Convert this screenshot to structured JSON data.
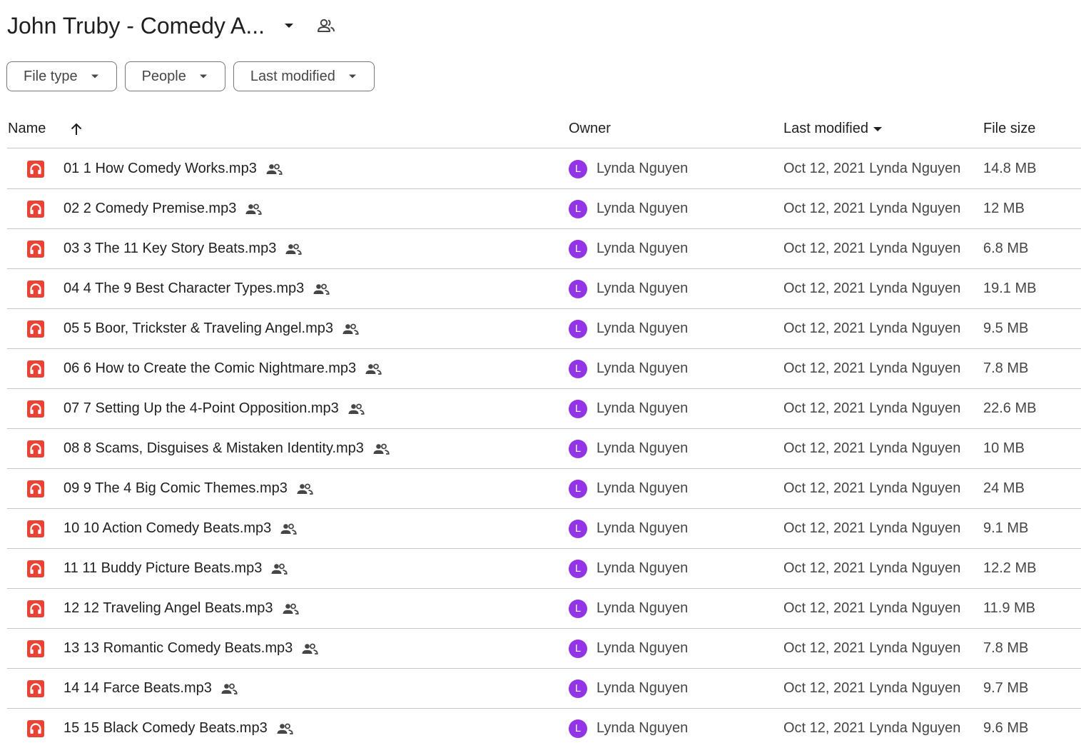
{
  "header": {
    "title": "John Truby - Comedy A..."
  },
  "filters": [
    {
      "label": "File type"
    },
    {
      "label": "People"
    },
    {
      "label": "Last modified"
    }
  ],
  "table": {
    "columns": {
      "name": "Name",
      "owner": "Owner",
      "modified": "Last modified",
      "size": "File size"
    },
    "rows": [
      {
        "name": "01 1 How Comedy Works.mp3",
        "owner": "Lynda Nguyen",
        "avatar": "L",
        "modified": "Oct 12, 2021 Lynda Nguyen",
        "size": "14.8 MB"
      },
      {
        "name": "02 2 Comedy Premise.mp3",
        "owner": "Lynda Nguyen",
        "avatar": "L",
        "modified": "Oct 12, 2021 Lynda Nguyen",
        "size": "12 MB"
      },
      {
        "name": "03 3 The 11 Key Story Beats.mp3",
        "owner": "Lynda Nguyen",
        "avatar": "L",
        "modified": "Oct 12, 2021 Lynda Nguyen",
        "size": "6.8 MB"
      },
      {
        "name": "04 4 The 9 Best Character Types.mp3",
        "owner": "Lynda Nguyen",
        "avatar": "L",
        "modified": "Oct 12, 2021 Lynda Nguyen",
        "size": "19.1 MB"
      },
      {
        "name": "05 5 Boor, Trickster & Traveling Angel.mp3",
        "owner": "Lynda Nguyen",
        "avatar": "L",
        "modified": "Oct 12, 2021 Lynda Nguyen",
        "size": "9.5 MB"
      },
      {
        "name": "06 6 How to Create the Comic Nightmare.mp3",
        "owner": "Lynda Nguyen",
        "avatar": "L",
        "modified": "Oct 12, 2021 Lynda Nguyen",
        "size": "7.8 MB"
      },
      {
        "name": "07 7 Setting Up the 4-Point Opposition.mp3",
        "owner": "Lynda Nguyen",
        "avatar": "L",
        "modified": "Oct 12, 2021 Lynda Nguyen",
        "size": "22.6 MB"
      },
      {
        "name": "08 8 Scams, Disguises & Mistaken Identity.mp3",
        "owner": "Lynda Nguyen",
        "avatar": "L",
        "modified": "Oct 12, 2021 Lynda Nguyen",
        "size": "10 MB"
      },
      {
        "name": "09 9 The 4 Big Comic Themes.mp3",
        "owner": "Lynda Nguyen",
        "avatar": "L",
        "modified": "Oct 12, 2021 Lynda Nguyen",
        "size": "24 MB"
      },
      {
        "name": "10 10 Action Comedy Beats.mp3",
        "owner": "Lynda Nguyen",
        "avatar": "L",
        "modified": "Oct 12, 2021 Lynda Nguyen",
        "size": "9.1 MB"
      },
      {
        "name": "11 11 Buddy Picture Beats.mp3",
        "owner": "Lynda Nguyen",
        "avatar": "L",
        "modified": "Oct 12, 2021 Lynda Nguyen",
        "size": "12.2 MB"
      },
      {
        "name": "12 12 Traveling Angel Beats.mp3",
        "owner": "Lynda Nguyen",
        "avatar": "L",
        "modified": "Oct 12, 2021 Lynda Nguyen",
        "size": "11.9 MB"
      },
      {
        "name": "13 13 Romantic Comedy Beats.mp3",
        "owner": "Lynda Nguyen",
        "avatar": "L",
        "modified": "Oct 12, 2021 Lynda Nguyen",
        "size": "7.8 MB"
      },
      {
        "name": "14 14 Farce Beats.mp3",
        "owner": "Lynda Nguyen",
        "avatar": "L",
        "modified": "Oct 12, 2021 Lynda Nguyen",
        "size": "9.7 MB"
      },
      {
        "name": "15 15 Black Comedy Beats.mp3",
        "owner": "Lynda Nguyen",
        "avatar": "L",
        "modified": "Oct 12, 2021 Lynda Nguyen",
        "size": "9.6 MB"
      }
    ]
  },
  "icons": {
    "file_type": "audio-file-icon",
    "shared": "shared-people-icon",
    "sort": "arrow-up-icon",
    "title_dropdown": "caret-down-icon",
    "title_share": "shared-folder-icon"
  },
  "colors": {
    "audio_icon": "#ea4335",
    "avatar": "#9334e6",
    "divider": "#c4c7c5",
    "chip_border": "#747775"
  }
}
